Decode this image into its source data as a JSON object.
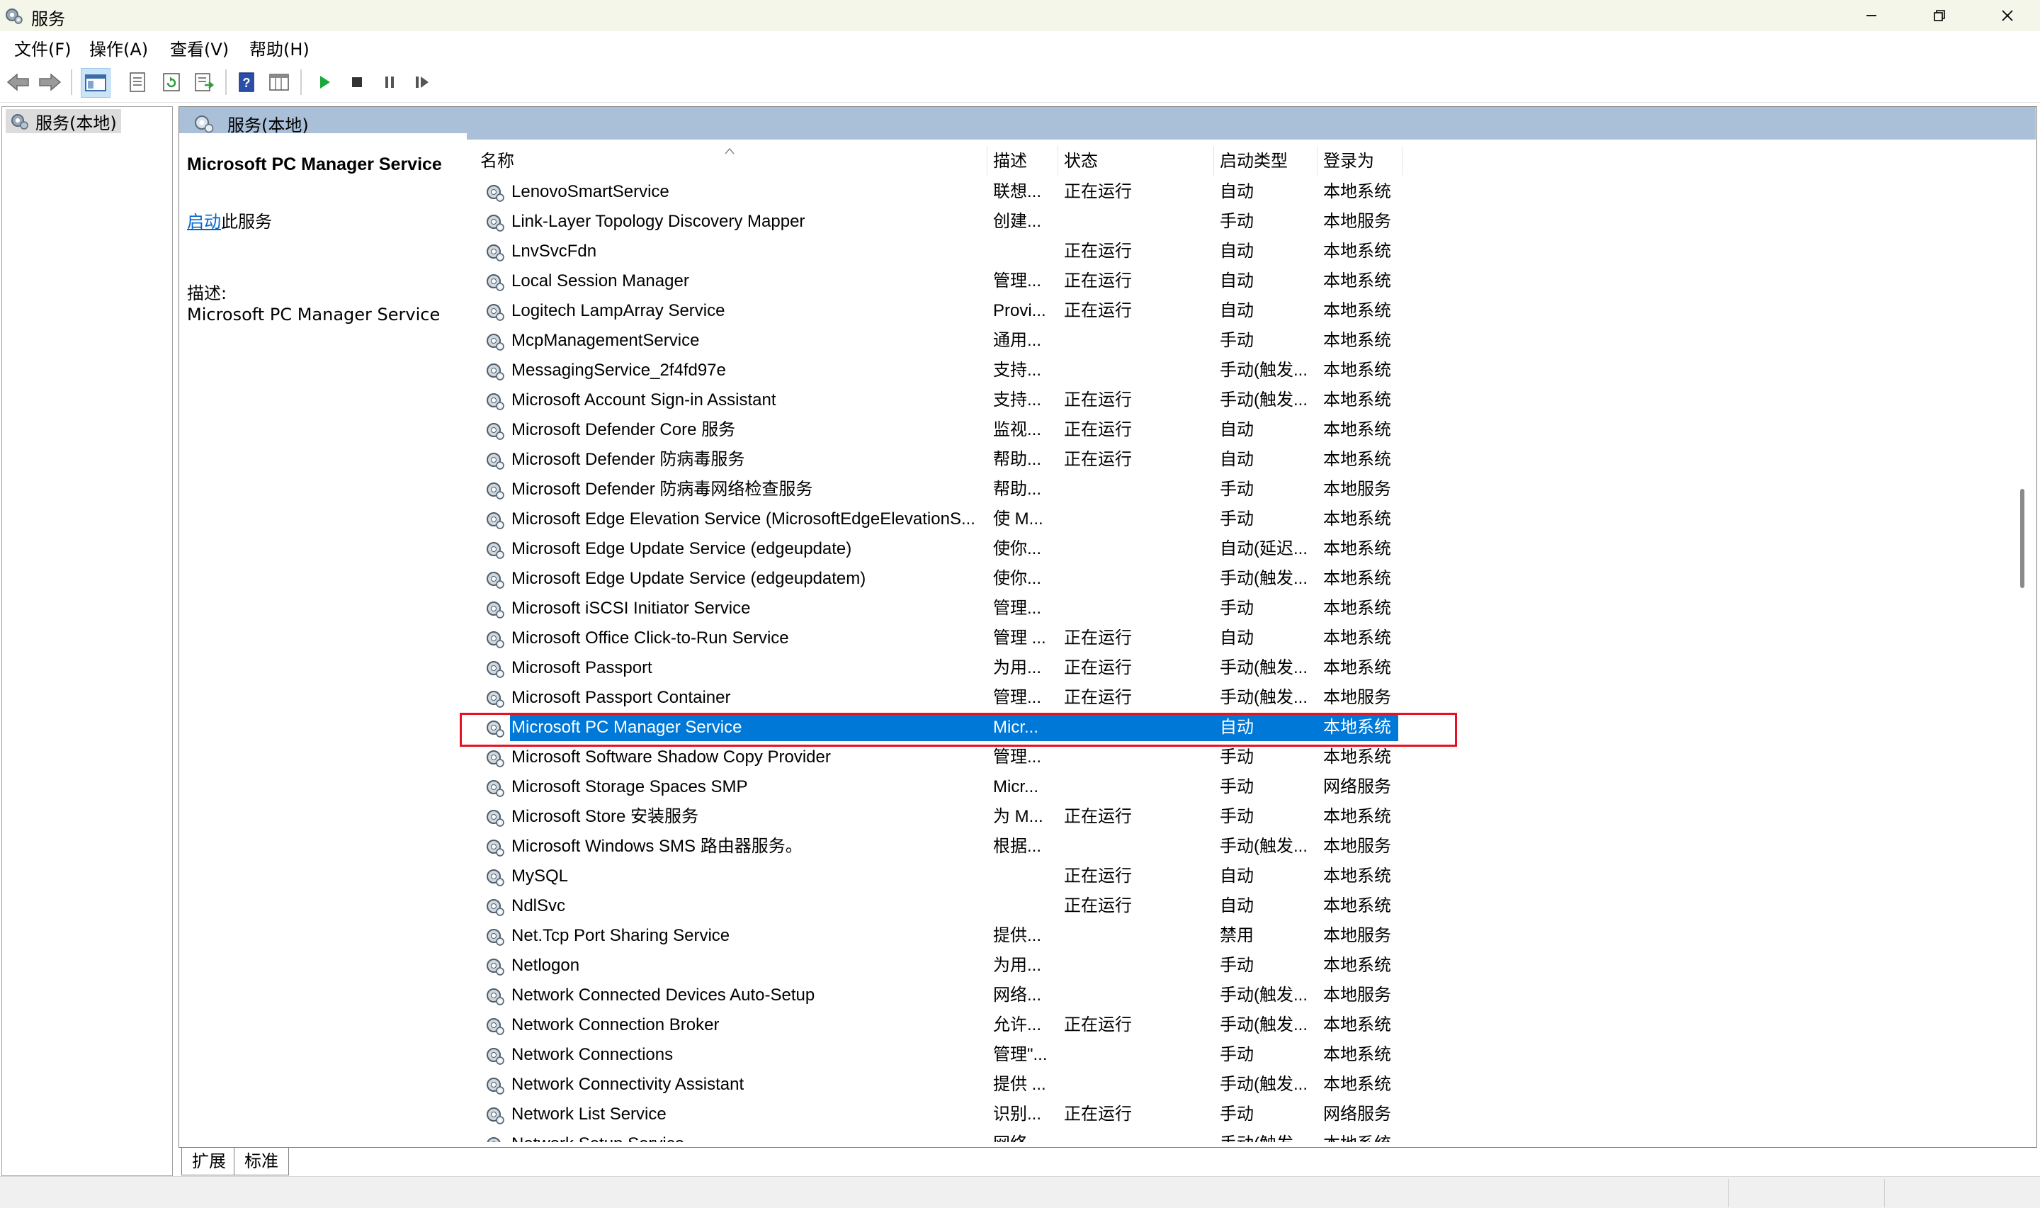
{
  "window": {
    "title": "服务",
    "icon": "gears-icon",
    "controls": [
      "minimize-icon",
      "restore-icon",
      "close-icon"
    ]
  },
  "menu": [
    "文件(F)",
    "操作(A)",
    "查看(V)",
    "帮助(H)"
  ],
  "toolbar": {
    "buttons": [
      "back-arrow-icon",
      "forward-arrow-icon",
      "console-tree-icon",
      "properties-icon",
      "refresh-icon",
      "export-list-icon",
      "help-icon",
      "view-icon",
      "start-service-icon",
      "stop-service-icon",
      "pause-service-icon",
      "resume-service-icon"
    ]
  },
  "tree": {
    "root_label": "服务(本地)"
  },
  "panel": {
    "header": "服务(本地)"
  },
  "detail": {
    "title": "Microsoft PC Manager Service",
    "start_link": "启动",
    "start_suffix": "此服务",
    "desc_label": "描述:",
    "desc_text": "Microsoft PC Manager Service"
  },
  "columns": {
    "name": "名称",
    "desc": "描述",
    "status": "状态",
    "startup": "启动类型",
    "logon": "登录为"
  },
  "services": [
    {
      "name": "LenovoSmartService",
      "desc": "联想...",
      "status": "正在运行",
      "startup": "自动",
      "logon": "本地系统"
    },
    {
      "name": "Link-Layer Topology Discovery Mapper",
      "desc": "创建...",
      "status": "",
      "startup": "手动",
      "logon": "本地服务"
    },
    {
      "name": "LnvSvcFdn",
      "desc": "",
      "status": "正在运行",
      "startup": "自动",
      "logon": "本地系统"
    },
    {
      "name": "Local Session Manager",
      "desc": "管理...",
      "status": "正在运行",
      "startup": "自动",
      "logon": "本地系统"
    },
    {
      "name": "Logitech LampArray Service",
      "desc": "Provi...",
      "status": "正在运行",
      "startup": "自动",
      "logon": "本地系统"
    },
    {
      "name": "McpManagementService",
      "desc": "通用...",
      "status": "",
      "startup": "手动",
      "logon": "本地系统"
    },
    {
      "name": "MessagingService_2f4fd97e",
      "desc": "支持...",
      "status": "",
      "startup": "手动(触发...",
      "logon": "本地系统"
    },
    {
      "name": "Microsoft Account Sign-in Assistant",
      "desc": "支持...",
      "status": "正在运行",
      "startup": "手动(触发...",
      "logon": "本地系统"
    },
    {
      "name": "Microsoft Defender Core 服务",
      "desc": "监视...",
      "status": "正在运行",
      "startup": "自动",
      "logon": "本地系统"
    },
    {
      "name": "Microsoft Defender 防病毒服务",
      "desc": "帮助...",
      "status": "正在运行",
      "startup": "自动",
      "logon": "本地系统"
    },
    {
      "name": "Microsoft Defender 防病毒网络检查服务",
      "desc": "帮助...",
      "status": "",
      "startup": "手动",
      "logon": "本地服务"
    },
    {
      "name": "Microsoft Edge Elevation Service (MicrosoftEdgeElevationS...",
      "desc": "使 M...",
      "status": "",
      "startup": "手动",
      "logon": "本地系统"
    },
    {
      "name": "Microsoft Edge Update Service (edgeupdate)",
      "desc": "使你...",
      "status": "",
      "startup": "自动(延迟...",
      "logon": "本地系统"
    },
    {
      "name": "Microsoft Edge Update Service (edgeupdatem)",
      "desc": "使你...",
      "status": "",
      "startup": "手动(触发...",
      "logon": "本地系统"
    },
    {
      "name": "Microsoft iSCSI Initiator Service",
      "desc": "管理...",
      "status": "",
      "startup": "手动",
      "logon": "本地系统"
    },
    {
      "name": "Microsoft Office Click-to-Run Service",
      "desc": "管理 ...",
      "status": "正在运行",
      "startup": "自动",
      "logon": "本地系统"
    },
    {
      "name": "Microsoft Passport",
      "desc": "为用...",
      "status": "正在运行",
      "startup": "手动(触发...",
      "logon": "本地系统"
    },
    {
      "name": "Microsoft Passport Container",
      "desc": "管理...",
      "status": "正在运行",
      "startup": "手动(触发...",
      "logon": "本地服务"
    },
    {
      "name": "Microsoft PC Manager Service",
      "desc": "Micr...",
      "status": "",
      "startup": "自动",
      "logon": "本地系统",
      "selected": true
    },
    {
      "name": "Microsoft Software Shadow Copy Provider",
      "desc": "管理...",
      "status": "",
      "startup": "手动",
      "logon": "本地系统"
    },
    {
      "name": "Microsoft Storage Spaces SMP",
      "desc": "Micr...",
      "status": "",
      "startup": "手动",
      "logon": "网络服务"
    },
    {
      "name": "Microsoft Store 安装服务",
      "desc": "为 M...",
      "status": "正在运行",
      "startup": "手动",
      "logon": "本地系统"
    },
    {
      "name": "Microsoft Windows SMS 路由器服务。",
      "desc": "根据...",
      "status": "",
      "startup": "手动(触发...",
      "logon": "本地服务"
    },
    {
      "name": "MySQL",
      "desc": "",
      "status": "正在运行",
      "startup": "自动",
      "logon": "本地系统"
    },
    {
      "name": "NdlSvc",
      "desc": "",
      "status": "正在运行",
      "startup": "自动",
      "logon": "本地系统"
    },
    {
      "name": "Net.Tcp Port Sharing Service",
      "desc": "提供...",
      "status": "",
      "startup": "禁用",
      "logon": "本地服务"
    },
    {
      "name": "Netlogon",
      "desc": "为用...",
      "status": "",
      "startup": "手动",
      "logon": "本地系统"
    },
    {
      "name": "Network Connected Devices Auto-Setup",
      "desc": "网络...",
      "status": "",
      "startup": "手动(触发...",
      "logon": "本地服务"
    },
    {
      "name": "Network Connection Broker",
      "desc": "允许...",
      "status": "正在运行",
      "startup": "手动(触发...",
      "logon": "本地系统"
    },
    {
      "name": "Network Connections",
      "desc": "管理\"...",
      "status": "",
      "startup": "手动",
      "logon": "本地系统"
    },
    {
      "name": "Network Connectivity Assistant",
      "desc": "提供 ...",
      "status": "",
      "startup": "手动(触发...",
      "logon": "本地系统"
    },
    {
      "name": "Network List Service",
      "desc": "识别...",
      "status": "正在运行",
      "startup": "手动",
      "logon": "网络服务"
    },
    {
      "name": "Network Setup Service",
      "desc": "网络...",
      "status": "",
      "startup": "手动(触发...",
      "logon": "本地系统"
    }
  ],
  "tabs": [
    "扩展",
    "标准"
  ],
  "colors": {
    "selection": "#0078d7",
    "header_bar": "#a9c0d8",
    "highlight_box": "#e81123",
    "link": "#0066cc"
  }
}
